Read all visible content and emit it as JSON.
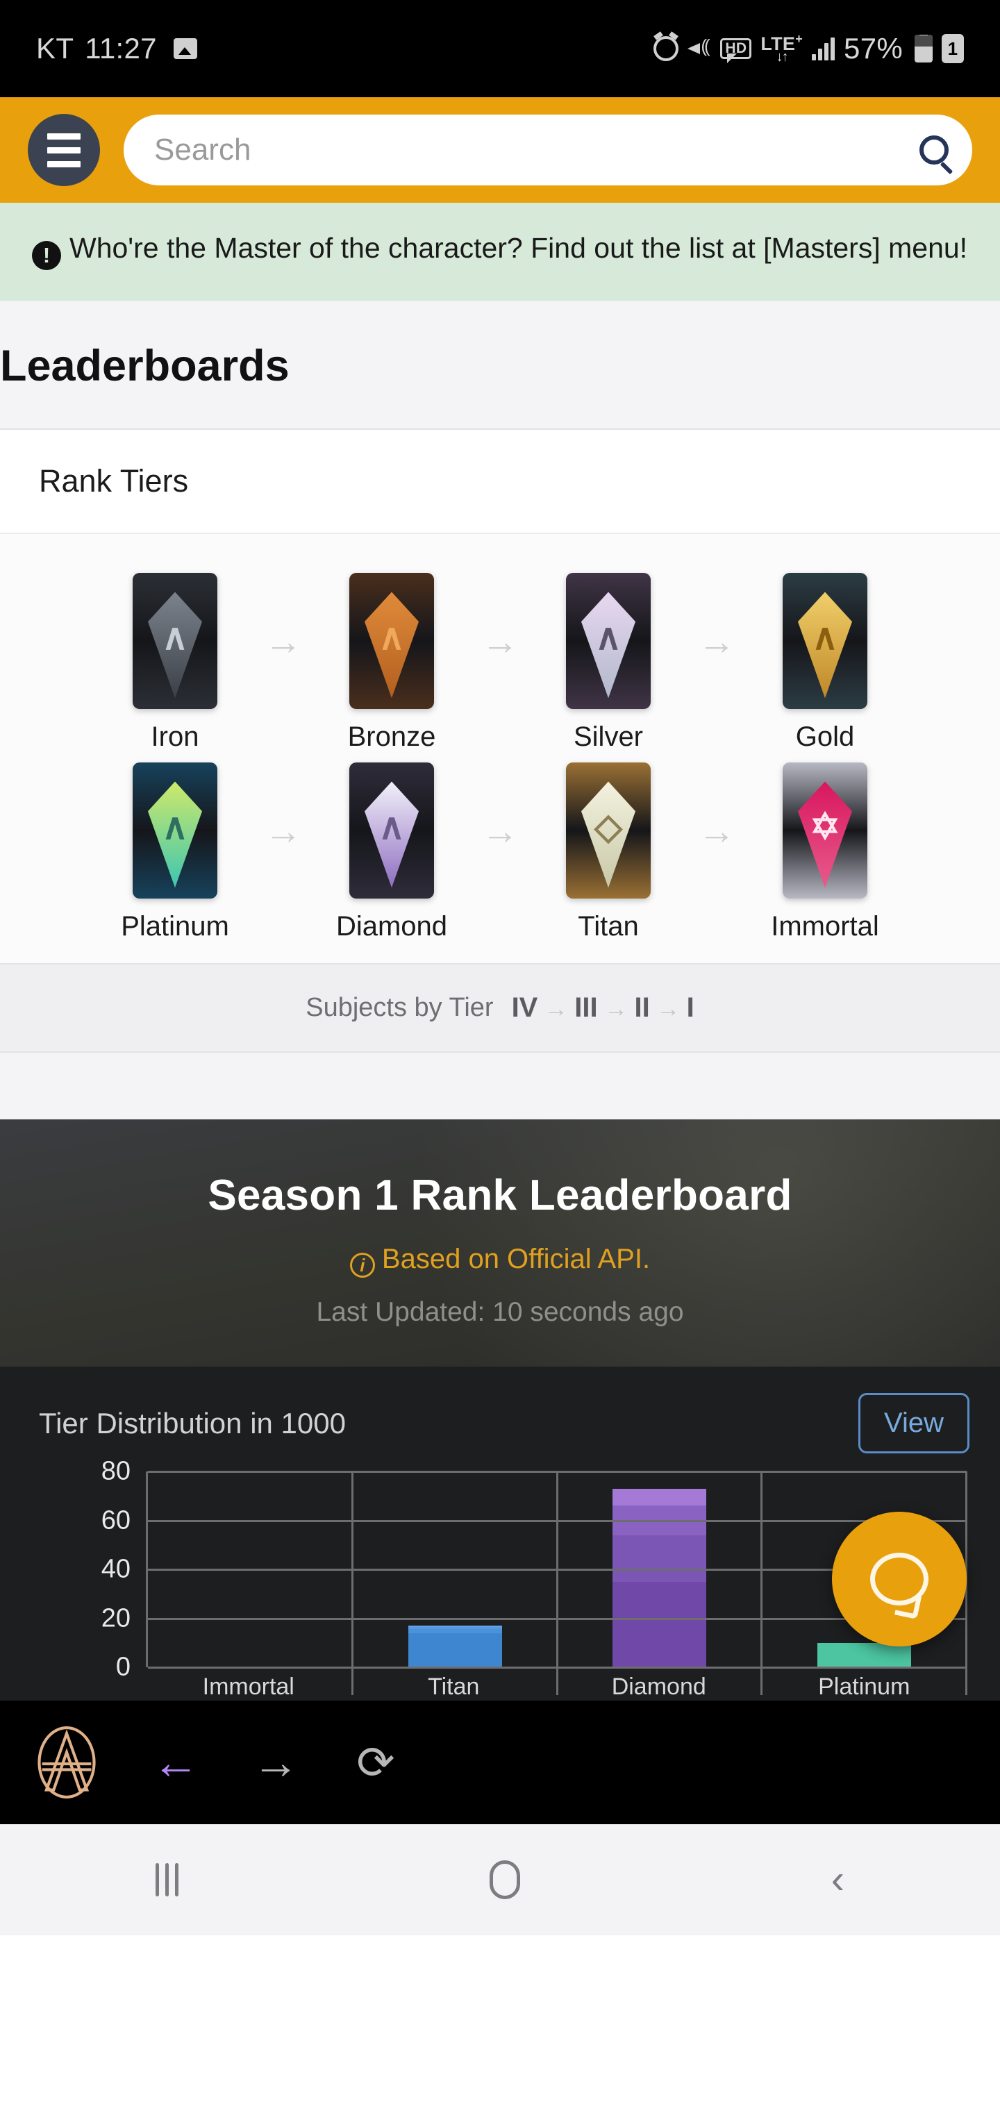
{
  "status_bar": {
    "carrier": "KT",
    "time": "11:27",
    "battery_percent": "57%",
    "sim_label": "1",
    "network_label": "LTE",
    "network_superscript": "+",
    "hd_label": "HD",
    "icons": [
      "screenshot-image-icon",
      "alarm-icon",
      "vibrate-mute-icon",
      "hd-voice-icon",
      "lte-plus-icon",
      "signal-bars-icon",
      "battery-icon",
      "sim-1-icon"
    ]
  },
  "app_bar": {
    "menu_icon": "hamburger-icon",
    "search_placeholder": "Search",
    "search_value": "",
    "search_icon": "search-icon",
    "background_color": "#e8a00d"
  },
  "notice": {
    "icon": "exclamation-icon",
    "icon_glyph": "!",
    "text": "Who're the Master of the character? Find out the list at [Masters] menu!",
    "background_color": "#d7ead9"
  },
  "page": {
    "title": "Leaderboards"
  },
  "rank_tiers_card": {
    "header": "Rank Tiers",
    "arrow_glyph": "→",
    "tiers": [
      {
        "name": "Iron",
        "glyph": "∧",
        "frame": "#2b2f35",
        "gem_top": "#7d838d",
        "gem_bottom": "#3b4048",
        "glyph_color": "#c9ced6"
      },
      {
        "name": "Bronze",
        "glyph": "∧",
        "frame": "#4a2e1c",
        "gem_top": "#e08b3a",
        "gem_bottom": "#b25f20",
        "glyph_color": "#f0a85c"
      },
      {
        "name": "Silver",
        "glyph": "∧",
        "frame": "#403446",
        "gem_top": "#e8d8f0",
        "gem_bottom": "#b3b8cc",
        "glyph_color": "#5d5368"
      },
      {
        "name": "Gold",
        "glyph": "∧",
        "frame": "#2c3c44",
        "gem_top": "#f0cf6a",
        "gem_bottom": "#c08828",
        "glyph_color": "#8a6010"
      },
      {
        "name": "Platinum",
        "glyph": "∧",
        "frame": "#17425c",
        "gem_top": "#cfe96a",
        "gem_bottom": "#3ec6b0",
        "glyph_color": "#2f6f62"
      },
      {
        "name": "Diamond",
        "glyph": "∧",
        "frame": "#2f2c3a",
        "gem_top": "#f2f0fa",
        "gem_bottom": "#8f6fc0",
        "glyph_color": "#6a5b8a"
      },
      {
        "name": "Titan",
        "glyph": "◇",
        "frame": "#9a7034",
        "gem_top": "#f4f2df",
        "gem_bottom": "#c8c8a8",
        "glyph_color": "#8c7f55"
      },
      {
        "name": "Immortal",
        "glyph": "✡",
        "frame": "#b8b8c4",
        "gem_top": "#d8175f",
        "gem_bottom": "#e85a8a",
        "glyph_color": "#ffe6ef"
      }
    ],
    "footer": {
      "label": "Subjects by Tier",
      "subjects": [
        "IV",
        "III",
        "II",
        "I"
      ],
      "arrow_glyph": "→"
    }
  },
  "hero": {
    "title": "Season 1 Rank Leaderboard",
    "api_note": "Based on Official API.",
    "api_icon": "info-icon",
    "api_icon_glyph": "i",
    "last_updated": "Last Updated: 10 seconds ago",
    "accent_color": "#e0a020"
  },
  "chart_panel": {
    "title": "Tier Distribution in 1000",
    "view_button": "View",
    "chat_button_icon": "chat-bubble-icon"
  },
  "chart_data": {
    "type": "bar",
    "title": "Tier Distribution in 1000",
    "xlabel": "",
    "ylabel": "",
    "ylim": [
      0,
      80
    ],
    "yticks": [
      0,
      20,
      40,
      60,
      80
    ],
    "grid": true,
    "legend": false,
    "stacked": true,
    "categories": [
      "Immortal",
      "Titan",
      "Diamond",
      "Platinum"
    ],
    "values": [
      0.3,
      17,
      73,
      10
    ],
    "bars": [
      {
        "category": "Immortal",
        "total": 0.3,
        "color": "#9b3a4e",
        "segments": [
          {
            "value": 0.3,
            "color": "#9b3a4e"
          }
        ]
      },
      {
        "category": "Titan",
        "total": 17,
        "color": "#3f86d0",
        "segments": [
          {
            "value": 14,
            "color": "#3f86d0"
          },
          {
            "value": 1.5,
            "color": "#4b92da"
          },
          {
            "value": 1.0,
            "color": "#5599e0"
          },
          {
            "value": 0.5,
            "color": "#63a3e6"
          }
        ]
      },
      {
        "category": "Diamond",
        "total": 73,
        "color": "#7b54ae",
        "segments": [
          {
            "value": 35,
            "color": "#7048a8"
          },
          {
            "value": 19,
            "color": "#7c56b4"
          },
          {
            "value": 12,
            "color": "#8a62c2"
          },
          {
            "value": 7,
            "color": "#a57ad6"
          }
        ]
      },
      {
        "category": "Platinum",
        "total": 10,
        "color": "#4cc5a0",
        "segments": [
          {
            "value": 10,
            "color": "#4cc5a0"
          }
        ]
      }
    ]
  },
  "browser_bar": {
    "brand_icon": "apex-logo-icon",
    "back_icon": "arrow-left-icon",
    "back_glyph": "←",
    "forward_icon": "arrow-right-icon",
    "forward_glyph": "→",
    "reload_icon": "reload-icon",
    "reload_glyph": "⟳"
  },
  "android_nav": {
    "recent_icon": "recent-apps-icon",
    "home_icon": "home-icon",
    "back_icon": "back-icon",
    "back_glyph": "‹"
  }
}
